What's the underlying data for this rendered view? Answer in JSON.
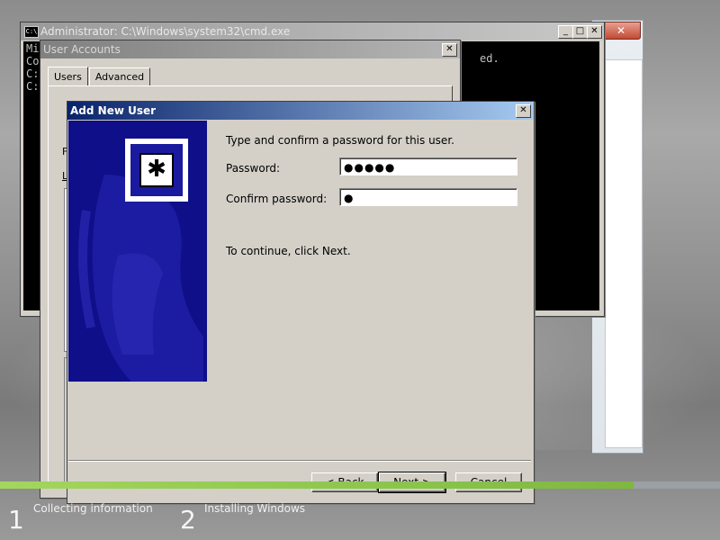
{
  "setup": {
    "steps": [
      {
        "number": "1",
        "label": "Collecting information"
      },
      {
        "number": "2",
        "label": "Installing Windows"
      }
    ]
  },
  "cmd_window": {
    "title": "Administrator: C:\\Windows\\system32\\cmd.exe",
    "icon_text": "C:\\",
    "lines": [
      "Mi",
      "Co",
      "",
      "C:",
      "",
      "C:"
    ],
    "fragment": "ed."
  },
  "user_accounts": {
    "title": "User Accounts",
    "tabs": [
      "Users",
      "Advanced"
    ],
    "partial_letters": [
      "F",
      "L"
    ]
  },
  "add_new_user": {
    "title": "Add New User",
    "instruction": "Type and confirm a password for this user.",
    "password_label": "Password:",
    "password_value": "●●●●●",
    "confirm_label": "Confirm password:",
    "confirm_value": "●",
    "continue_text": "To continue, click Next.",
    "buttons": {
      "back": "< Back",
      "next": "Next >",
      "cancel": "Cancel"
    }
  },
  "colors": {
    "accent_title": "#0a246a",
    "setup_green": "#88c34a",
    "sidebar_blue": "#0f0f8a"
  }
}
